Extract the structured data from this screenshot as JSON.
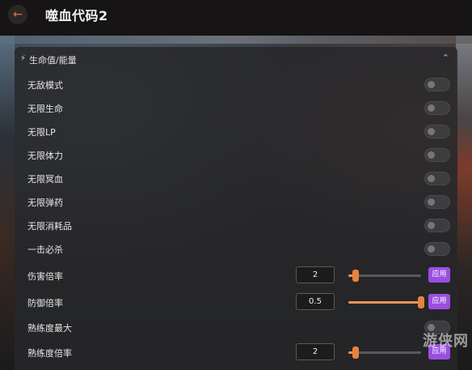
{
  "app": {
    "title": "噬血代码2",
    "back_icon": "arrow-left-icon",
    "accent_color": "#e2744a"
  },
  "section": {
    "title": "生命值/能量",
    "icon": "lightning-icon",
    "collapse_icon": "chevron-up-icon"
  },
  "toggles": [
    {
      "label": "无敌模式",
      "on": false
    },
    {
      "label": "无限生命",
      "on": false
    },
    {
      "label": "无限LP",
      "on": false
    },
    {
      "label": "无限体力",
      "on": false
    },
    {
      "label": "无限冥血",
      "on": false
    },
    {
      "label": "无限弹药",
      "on": false
    },
    {
      "label": "无限消耗品",
      "on": false
    },
    {
      "label": "一击必杀",
      "on": false
    }
  ],
  "damage_multiplier": {
    "label": "伤害倍率",
    "value": "2",
    "slider_fraction": 0.1,
    "apply_label": "应用"
  },
  "defense_multiplier": {
    "label": "防御倍率",
    "value": "0.5",
    "slider_fraction": 1.0,
    "apply_label": "应用"
  },
  "proficiency_max": {
    "label": "熟练度最大",
    "on": false
  },
  "proficiency_multiplier": {
    "label": "熟练度倍率",
    "value": "2",
    "slider_fraction": 0.1,
    "apply_label": "应用"
  },
  "colors": {
    "apply_button": "#9b4fe0",
    "slider_thumb": "#e8823f"
  },
  "watermark": "游侠网"
}
